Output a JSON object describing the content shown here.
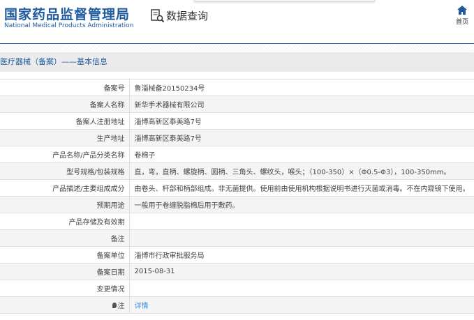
{
  "header": {
    "logo_cn": "国家药品监督管理局",
    "logo_en": "National Medical Products Administration",
    "query_label": "数据查询",
    "home_label": "首页"
  },
  "page_title": "医疗器械（备案）——基本信息",
  "rows": [
    {
      "label": "备案号",
      "value": "鲁淄械备20150234号"
    },
    {
      "label": "备案人名称",
      "value": "新华手术器械有限公司"
    },
    {
      "label": "备案人注册地址",
      "value": "淄博高新区泰美路7号"
    },
    {
      "label": "生产地址",
      "value": "淄博高新区泰美路7号"
    },
    {
      "label": "产品名称/产品分类名称",
      "value": "卷棉子"
    },
    {
      "label": "型号规格/包装规格",
      "value": "直，弯，直柄、螺旋柄、圆柄、三角头、螺纹头，喉头；（100-350）×（Φ0.5-Φ3），100-350mm。"
    },
    {
      "label": "产品描述/主要组成成分",
      "value": "由卷头、杆部和柄部组成。非无菌提供。使用前由使用机构根据说明书进行灭菌或消毒。不在内窥镜下使用。"
    },
    {
      "label": "预期用途",
      "value": "一般用于卷缠脱脂棉后用于敷药。"
    },
    {
      "label": "产品存储及有效期",
      "value": ""
    },
    {
      "label": "备注",
      "value": ""
    },
    {
      "label": "备案单位",
      "value": "淄博市行政审批服务局"
    },
    {
      "label": "备案日期",
      "value": "2015-08-31"
    },
    {
      "label": "变更情况",
      "value": ""
    }
  ],
  "note": {
    "label": "注",
    "link": "详情"
  }
}
